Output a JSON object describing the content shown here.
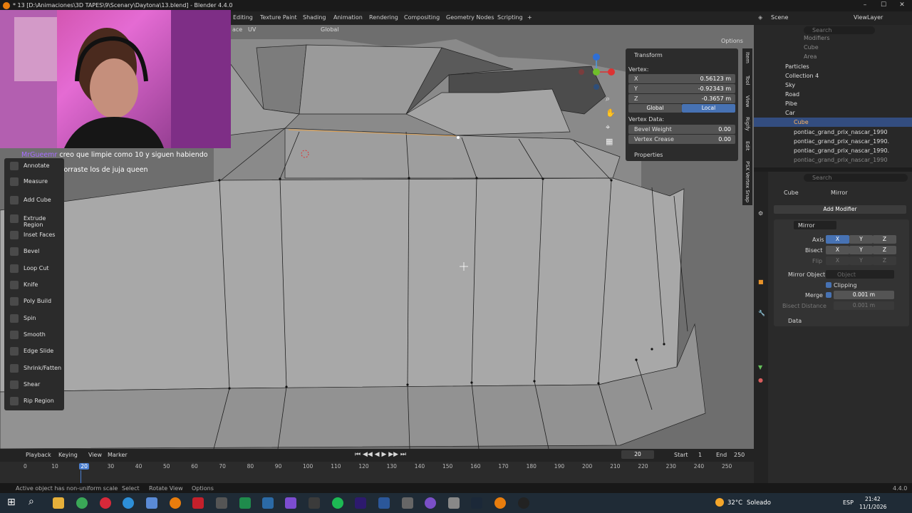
{
  "window": {
    "title": "* 13 [D:\\Animaciones\\3D TAPES\\9\\Scenary\\Daytona\\13.blend] - Blender 4.4.0",
    "minimize": "–",
    "maximize": "☐",
    "close": "✕"
  },
  "workspaces": [
    "Editing",
    "Texture Paint",
    "Shading",
    "Animation",
    "Rendering",
    "Compositing",
    "Geometry Nodes",
    "Scripting",
    "+"
  ],
  "scene_header": {
    "scene": "Scene",
    "view_layer": "ViewLayer"
  },
  "viewport_header": {
    "menu_face": "ace",
    "menu_uv": "UV",
    "orientation": "Global",
    "options": "Options"
  },
  "chat": [
    {
      "user": "MrGueemr",
      "text": "creo que limpie como 10 y siguen habiendo"
    },
    {
      "user": "odasaku_u",
      "text": "borraste los de juja queen"
    }
  ],
  "tools": [
    "Annotate",
    "Measure",
    "Add Cube",
    "Extrude Region",
    "Inset Faces",
    "Bevel",
    "Loop Cut",
    "Knife",
    "Poly Build",
    "Spin",
    "Smooth",
    "Edge Slide",
    "Shrink/Fatten",
    "Shear",
    "Rip Region"
  ],
  "npanel": {
    "transform_label": "Transform",
    "vertex_label": "Vertex:",
    "x_label": "X",
    "x_value": "0.56123 m",
    "y_label": "Y",
    "y_value": "-0.92343 m",
    "z_label": "Z",
    "z_value": "-0.3657 m",
    "global": "Global",
    "local": "Local",
    "vertex_data": "Vertex Data:",
    "bevel_weight_label": "Bevel Weight",
    "bevel_weight_value": "0.00",
    "vertex_crease_label": "Vertex Crease",
    "vertex_crease_value": "0.00",
    "properties": "Properties"
  },
  "side_tabs": [
    "Item",
    "Tool",
    "View",
    "Rigify",
    "Edit",
    "PSX Vertex Snap"
  ],
  "outliner": {
    "search_placeholder": "Search",
    "items": [
      "Modifiers",
      "Cube",
      "Area",
      "Particles",
      "Collection 4",
      "Sky",
      "Road",
      "Pibe",
      "Car",
      "Cube",
      "pontiac_grand_prix_nascar_1990",
      "pontiac_grand_prix_nascar_1990.",
      "pontiac_grand_prix_nascar_1990.",
      "pontiac_grand_prix_nascar_1990"
    ]
  },
  "properties": {
    "search_placeholder": "Search",
    "breadcrumb_object": "Cube",
    "breadcrumb_modifier": "Mirror",
    "add_modifier": "Add Modifier",
    "modifier_name": "Mirror",
    "axis_label": "Axis",
    "bisect_label": "Bisect",
    "flip_label": "Flip",
    "x": "X",
    "y": "Y",
    "z": "Z",
    "mirror_object_label": "Mirror Object",
    "mirror_object_placeholder": "Object",
    "clipping": "Clipping",
    "merge_label": "Merge",
    "merge_value": "0.001 m",
    "bisect_distance_label": "Bisect Distance",
    "bisect_distance_value": "0.001 m",
    "data": "Data"
  },
  "timeline": {
    "playback": "Playback",
    "keying": "Keying",
    "view": "View",
    "marker": "Marker",
    "current_frame": "20",
    "start_label": "Start",
    "start_value": "1",
    "end_label": "End",
    "end_value": "250",
    "ticks": [
      "0",
      "10",
      "20",
      "30",
      "40",
      "50",
      "60",
      "70",
      "80",
      "90",
      "100",
      "110",
      "120",
      "130",
      "140",
      "150",
      "160",
      "170",
      "180",
      "190",
      "200",
      "210",
      "220",
      "230",
      "240",
      "250"
    ]
  },
  "status": {
    "message": "Active object has non-uniform scale",
    "select": "Select",
    "rotate": "Rotate View",
    "options": "Options",
    "version": "4.4.0"
  },
  "taskbar": {
    "weather_temp": "32°C",
    "weather_text": "Soleado",
    "lang": "ESP",
    "time": "21:42",
    "date": "11/1/2026"
  }
}
